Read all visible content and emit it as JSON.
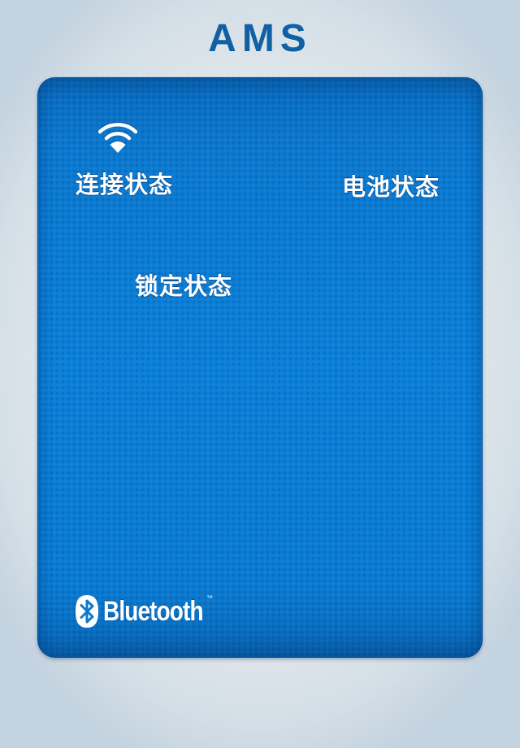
{
  "app": {
    "title": "AMS"
  },
  "panel": {
    "connection_icon": "wifi-icon",
    "connection_label": "连接状态",
    "battery_label": "电池状态",
    "lock_label": "锁定状态"
  },
  "footer_logo": {
    "icon": "bluetooth-icon",
    "wordmark": "Bluetooth",
    "trademark": "™"
  },
  "colors": {
    "title": "#1060a3",
    "panel": "#0b80d8",
    "panel_text": "#ffffff",
    "background": "#e1e7eb"
  }
}
